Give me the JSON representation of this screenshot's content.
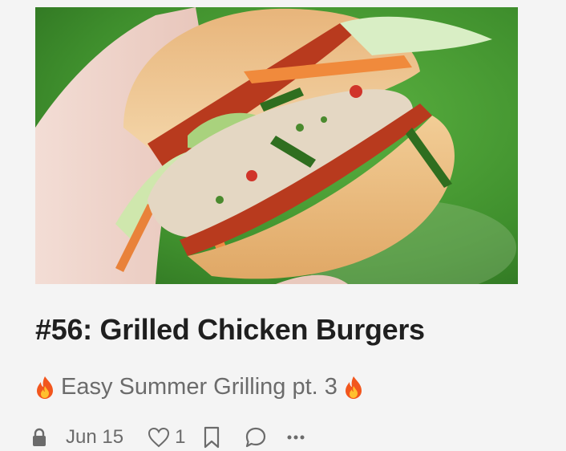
{
  "post": {
    "title": "#56: Grilled Chicken Burgers",
    "subtitle": "Easy Summer Grilling pt. 3",
    "date": "Jun 15",
    "like_count": "1"
  },
  "icons": {
    "lock": "lock-icon",
    "like": "heart-icon",
    "bookmark": "bookmark-icon",
    "comment": "comment-icon",
    "more": "more-icon",
    "flame": "fire-emoji"
  },
  "colors": {
    "title": "#1f1f1f",
    "muted": "#6b6b6b",
    "background": "#f4f4f4"
  }
}
